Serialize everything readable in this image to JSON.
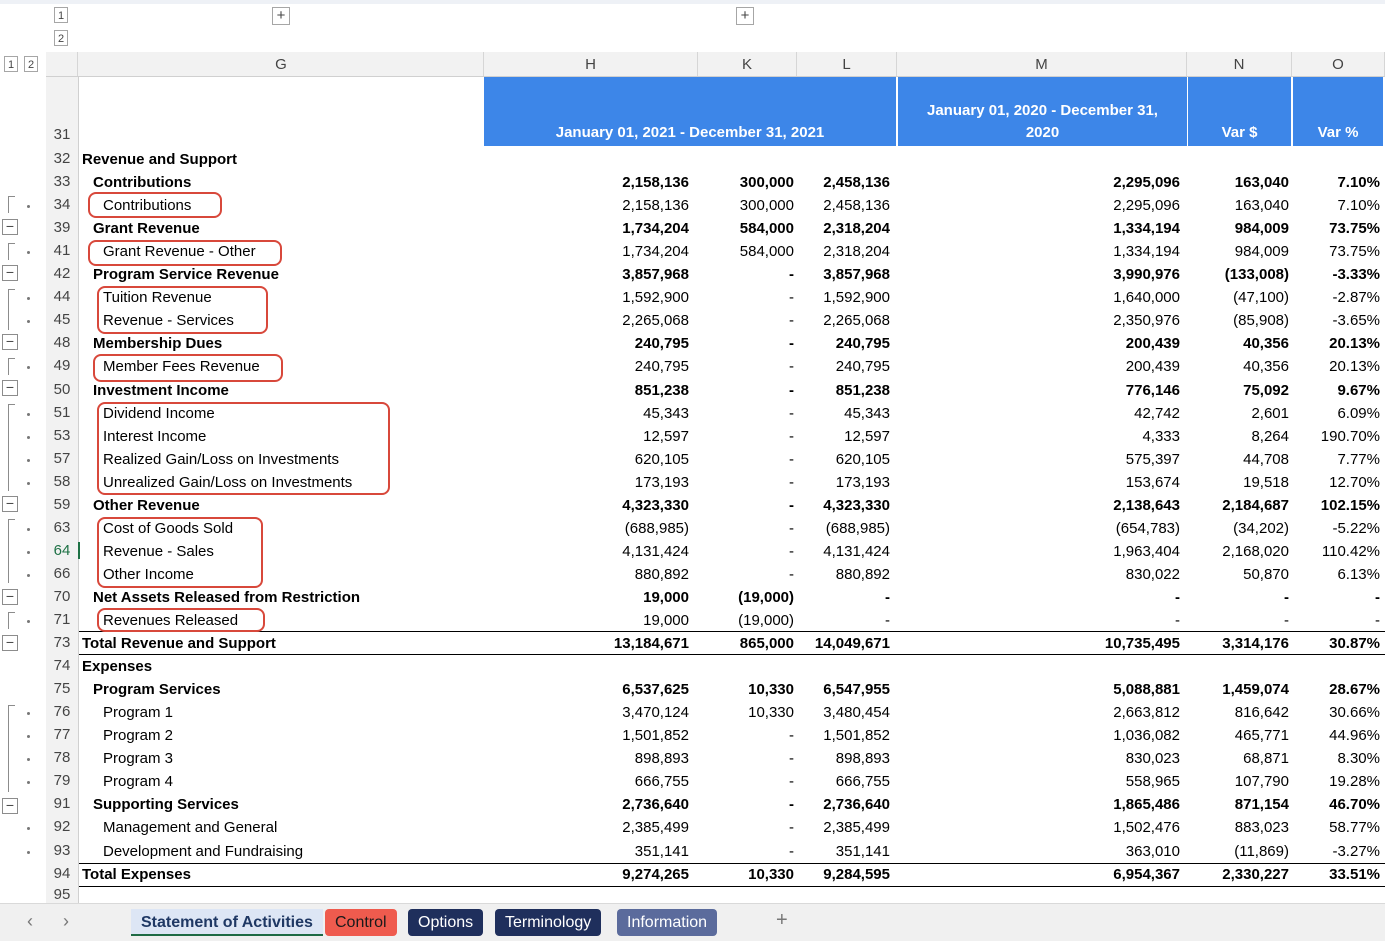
{
  "outline": {
    "row_levels": [
      "1",
      "2"
    ],
    "col_levels": [
      "1",
      "2"
    ],
    "expand": "+",
    "collapse": "−"
  },
  "columns": [
    "G",
    "H",
    "K",
    "L",
    "M",
    "N",
    "O"
  ],
  "header": {
    "period_current": "January 01, 2021 - December 31, 2021",
    "period_prior_line1": "January 01, 2020 - December 31,",
    "period_prior_line2": "2020",
    "var_dollar": "Var $",
    "var_pct": "Var %"
  },
  "header_row_number": "31",
  "last_row_number": "95",
  "rows": [
    {
      "num": "32",
      "label": "Revenue and Support",
      "bold": true,
      "indent": 0,
      "h": "",
      "k": "",
      "l": "",
      "m": "",
      "n": "",
      "o": ""
    },
    {
      "num": "33",
      "label": "Contributions",
      "bold": true,
      "indent": 1,
      "h": "2,158,136",
      "k": "300,000",
      "l": "2,458,136",
      "m": "2,295,096",
      "n": "163,040",
      "o": "7.10%"
    },
    {
      "num": "34",
      "label": "Contributions",
      "bold": false,
      "indent": 2,
      "h": "2,158,136",
      "k": "300,000",
      "l": "2,458,136",
      "m": "2,295,096",
      "n": "163,040",
      "o": "7.10%"
    },
    {
      "num": "39",
      "label": "Grant Revenue",
      "bold": true,
      "indent": 1,
      "h": "1,734,204",
      "k": "584,000",
      "l": "2,318,204",
      "m": "1,334,194",
      "n": "984,009",
      "o": "73.75%"
    },
    {
      "num": "41",
      "label": "Grant Revenue - Other",
      "bold": false,
      "indent": 2,
      "h": "1,734,204",
      "k": "584,000",
      "l": "2,318,204",
      "m": "1,334,194",
      "n": "984,009",
      "o": "73.75%"
    },
    {
      "num": "42",
      "label": "Program Service Revenue",
      "bold": true,
      "indent": 1,
      "h": "3,857,968",
      "k": "-",
      "l": "3,857,968",
      "m": "3,990,976",
      "n": "(133,008)",
      "o": "-3.33%"
    },
    {
      "num": "44",
      "label": "Tuition Revenue",
      "bold": false,
      "indent": 2,
      "h": "1,592,900",
      "k": "-",
      "l": "1,592,900",
      "m": "1,640,000",
      "n": "(47,100)",
      "o": "-2.87%"
    },
    {
      "num": "45",
      "label": "Revenue - Services",
      "bold": false,
      "indent": 2,
      "h": "2,265,068",
      "k": "-",
      "l": "2,265,068",
      "m": "2,350,976",
      "n": "(85,908)",
      "o": "-3.65%"
    },
    {
      "num": "48",
      "label": "Membership Dues",
      "bold": true,
      "indent": 1,
      "h": "240,795",
      "k": "-",
      "l": "240,795",
      "m": "200,439",
      "n": "40,356",
      "o": "20.13%"
    },
    {
      "num": "49",
      "label": "Member Fees Revenue",
      "bold": false,
      "indent": 2,
      "h": "240,795",
      "k": "-",
      "l": "240,795",
      "m": "200,439",
      "n": "40,356",
      "o": "20.13%"
    },
    {
      "num": "50",
      "label": "Investment Income",
      "bold": true,
      "indent": 1,
      "h": "851,238",
      "k": "-",
      "l": "851,238",
      "m": "776,146",
      "n": "75,092",
      "o": "9.67%"
    },
    {
      "num": "51",
      "label": "Dividend Income",
      "bold": false,
      "indent": 2,
      "h": "45,343",
      "k": "-",
      "l": "45,343",
      "m": "42,742",
      "n": "2,601",
      "o": "6.09%"
    },
    {
      "num": "53",
      "label": "Interest Income",
      "bold": false,
      "indent": 2,
      "h": "12,597",
      "k": "-",
      "l": "12,597",
      "m": "4,333",
      "n": "8,264",
      "o": "190.70%"
    },
    {
      "num": "57",
      "label": "Realized Gain/Loss on Investments",
      "bold": false,
      "indent": 2,
      "h": "620,105",
      "k": "-",
      "l": "620,105",
      "m": "575,397",
      "n": "44,708",
      "o": "7.77%"
    },
    {
      "num": "58",
      "label": "Unrealized Gain/Loss on Investments",
      "bold": false,
      "indent": 2,
      "h": "173,193",
      "k": "-",
      "l": "173,193",
      "m": "153,674",
      "n": "19,518",
      "o": "12.70%"
    },
    {
      "num": "59",
      "label": "Other Revenue",
      "bold": true,
      "indent": 1,
      "h": "4,323,330",
      "k": "-",
      "l": "4,323,330",
      "m": "2,138,643",
      "n": "2,184,687",
      "o": "102.15%"
    },
    {
      "num": "63",
      "label": "Cost of Goods Sold",
      "bold": false,
      "indent": 2,
      "h": "(688,985)",
      "k": "-",
      "l": "(688,985)",
      "m": "(654,783)",
      "n": "(34,202)",
      "o": "-5.22%"
    },
    {
      "num": "64",
      "label": "Revenue - Sales",
      "bold": false,
      "indent": 2,
      "h": "4,131,424",
      "k": "-",
      "l": "4,131,424",
      "m": "1,963,404",
      "n": "2,168,020",
      "o": "110.42%"
    },
    {
      "num": "66",
      "label": "Other Income",
      "bold": false,
      "indent": 2,
      "h": "880,892",
      "k": "-",
      "l": "880,892",
      "m": "830,022",
      "n": "50,870",
      "o": "6.13%"
    },
    {
      "num": "70",
      "label": "Net Assets Released from Restriction",
      "bold": true,
      "indent": 1,
      "h": "19,000",
      "k": "(19,000)",
      "l": "-",
      "m": "-",
      "n": "-",
      "o": "-"
    },
    {
      "num": "71",
      "label": "Revenues Released",
      "bold": false,
      "indent": 2,
      "h": "19,000",
      "k": "(19,000)",
      "l": "-",
      "m": "-",
      "n": "-",
      "o": "-"
    },
    {
      "num": "73",
      "label": "Total Revenue and Support",
      "bold": true,
      "indent": 0,
      "h": "13,184,671",
      "k": "865,000",
      "l": "14,049,671",
      "m": "10,735,495",
      "n": "3,314,176",
      "o": "30.87%"
    },
    {
      "num": "74",
      "label": "Expenses",
      "bold": true,
      "indent": 0,
      "h": "",
      "k": "",
      "l": "",
      "m": "",
      "n": "",
      "o": ""
    },
    {
      "num": "75",
      "label": "Program Services",
      "bold": true,
      "indent": 1,
      "h": "6,537,625",
      "k": "10,330",
      "l": "6,547,955",
      "m": "5,088,881",
      "n": "1,459,074",
      "o": "28.67%"
    },
    {
      "num": "76",
      "label": "Program 1",
      "bold": false,
      "indent": 2,
      "h": "3,470,124",
      "k": "10,330",
      "l": "3,480,454",
      "m": "2,663,812",
      "n": "816,642",
      "o": "30.66%"
    },
    {
      "num": "77",
      "label": "Program 2",
      "bold": false,
      "indent": 2,
      "h": "1,501,852",
      "k": "-",
      "l": "1,501,852",
      "m": "1,036,082",
      "n": "465,771",
      "o": "44.96%"
    },
    {
      "num": "78",
      "label": "Program 3",
      "bold": false,
      "indent": 2,
      "h": "898,893",
      "k": "-",
      "l": "898,893",
      "m": "830,023",
      "n": "68,871",
      "o": "8.30%"
    },
    {
      "num": "79",
      "label": "Program 4",
      "bold": false,
      "indent": 2,
      "h": "666,755",
      "k": "-",
      "l": "666,755",
      "m": "558,965",
      "n": "107,790",
      "o": "19.28%"
    },
    {
      "num": "91",
      "label": "Supporting Services",
      "bold": true,
      "indent": 1,
      "h": "2,736,640",
      "k": "-",
      "l": "2,736,640",
      "m": "1,865,486",
      "n": "871,154",
      "o": "46.70%"
    },
    {
      "num": "92",
      "label": "Management and General",
      "bold": false,
      "indent": 2,
      "h": "2,385,499",
      "k": "-",
      "l": "2,385,499",
      "m": "1,502,476",
      "n": "883,023",
      "o": "58.77%"
    },
    {
      "num": "93",
      "label": "Development and Fundraising",
      "bold": false,
      "indent": 2,
      "h": "351,141",
      "k": "-",
      "l": "351,141",
      "m": "363,010",
      "n": "(11,869)",
      "o": "-3.27%"
    },
    {
      "num": "94",
      "label": "Total Expenses",
      "bold": true,
      "indent": 0,
      "h": "9,274,265",
      "k": "10,330",
      "l": "9,284,595",
      "m": "6,954,367",
      "n": "2,330,227",
      "o": "33.51%"
    }
  ],
  "tabs": [
    {
      "label": "Statement of Activities",
      "bg": "#dde6f5",
      "fg": "#1f3864",
      "active": true
    },
    {
      "label": "Control",
      "bg": "#ef5b4e",
      "fg": "#1a1a1a",
      "active": false
    },
    {
      "label": "Options",
      "bg": "#1f2f5c",
      "fg": "#ffffff",
      "active": false
    },
    {
      "label": "Terminology",
      "bg": "#1f2f5c",
      "fg": "#ffffff",
      "active": false
    },
    {
      "label": "Information",
      "bg": "#5b6b9c",
      "fg": "#ffffff",
      "active": false
    }
  ],
  "tab_nav": {
    "prev": "‹",
    "next": "›",
    "add": "+"
  },
  "colors": {
    "header_blue": "#3d86e8",
    "highlight": "#d8483b"
  }
}
